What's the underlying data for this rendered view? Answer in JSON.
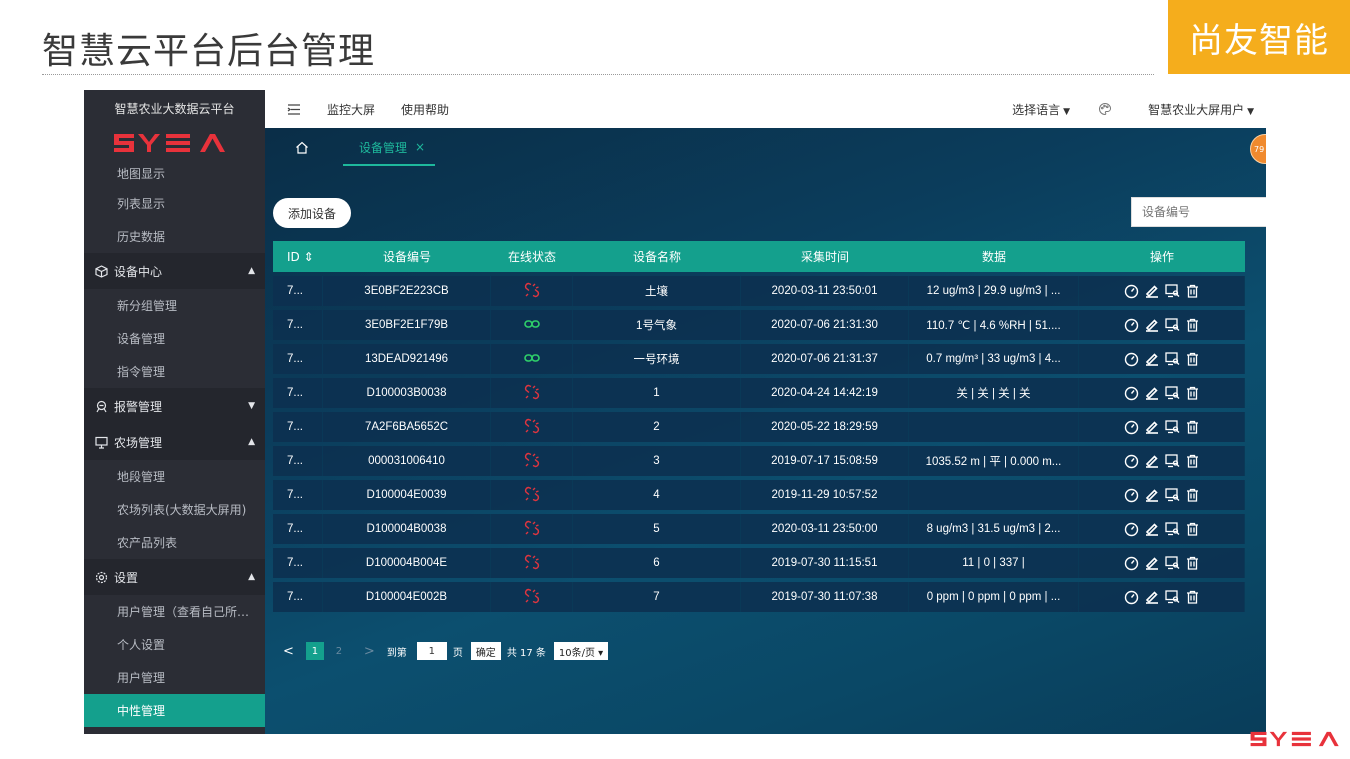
{
  "slide": {
    "title": "智慧云平台后台管理",
    "brand": "尚友智能"
  },
  "sidebar": {
    "title": "智慧农业大数据云平台",
    "items_top": [
      "地图显示",
      "列表显示",
      "历史数据"
    ],
    "group_device": {
      "label": "设备中心",
      "icon": "cube-icon"
    },
    "items_device": [
      "新分组管理",
      "设备管理",
      "指令管理"
    ],
    "group_alarm": {
      "label": "报警管理",
      "icon": "alarm-icon"
    },
    "group_farm": {
      "label": "农场管理",
      "icon": "monitor-icon"
    },
    "items_farm": [
      "地段管理",
      "农场列表(大数据大屏用)",
      "农产品列表"
    ],
    "group_settings": {
      "label": "设置",
      "icon": "gear-icon"
    },
    "items_settings": [
      "用户管理（查看自己所…",
      "个人设置",
      "用户管理",
      "中性管理"
    ]
  },
  "topbar": {
    "nav": [
      "监控大屏",
      "使用帮助"
    ],
    "language": "选择语言",
    "user": "智慧农业大屏用户"
  },
  "tabs": {
    "active": "设备管理",
    "close": "×",
    "badge": "79"
  },
  "toolbar": {
    "add_label": "添加设备",
    "search_placeholder": "设备编号"
  },
  "table": {
    "headers": [
      "ID",
      "设备编号",
      "在线状态",
      "设备名称",
      "采集时间",
      "数据",
      "操作"
    ],
    "sort_icon": "⇕",
    "rows": [
      {
        "id": "7...",
        "code": "3E0BF2E223CB",
        "online": false,
        "name": "土壤",
        "time": "2020-03-11 23:50:01",
        "data": "12 ug/m3 | 29.9 ug/m3 | ..."
      },
      {
        "id": "7...",
        "code": "3E0BF2E1F79B",
        "online": true,
        "name": "1号气象",
        "time": "2020-07-06 21:31:30",
        "data": "110.7 ℃ | 4.6 %RH | 51...."
      },
      {
        "id": "7...",
        "code": "13DEAD921496",
        "online": true,
        "name": "一号环境",
        "time": "2020-07-06 21:31:37",
        "data": "0.7 mg/m³ | 33 ug/m3 | 4..."
      },
      {
        "id": "7...",
        "code": "D100003B0038",
        "online": false,
        "name": "1",
        "time": "2020-04-24 14:42:19",
        "data": "关 | 关 | 关 | 关"
      },
      {
        "id": "7...",
        "code": "7A2F6BA5652C",
        "online": false,
        "name": "2",
        "time": "2020-05-22 18:29:59",
        "data": ""
      },
      {
        "id": "7...",
        "code": "000031006410",
        "online": false,
        "name": "3",
        "time": "2019-07-17 15:08:59",
        "data": "1035.52 m | 平 | 0.000 m..."
      },
      {
        "id": "7...",
        "code": "D100004E0039",
        "online": false,
        "name": "4",
        "time": "2019-11-29 10:57:52",
        "data": ""
      },
      {
        "id": "7...",
        "code": "D100004B0038",
        "online": false,
        "name": "5",
        "time": "2020-03-11 23:50:00",
        "data": "8 ug/m3 | 31.5 ug/m3 | 2..."
      },
      {
        "id": "7...",
        "code": "D100004B004E",
        "online": false,
        "name": "6",
        "time": "2019-07-30 11:15:51",
        "data": "11 | 0 | 337 |"
      },
      {
        "id": "7...",
        "code": "D100004E002B",
        "online": false,
        "name": "7",
        "time": "2019-07-30 11:07:38",
        "data": "0 ppm | 0 ppm | 0 ppm | ..."
      }
    ]
  },
  "pager": {
    "prev": "<",
    "page1": "1",
    "page2": "2",
    "next": ">",
    "goto_label": "到第",
    "goto_value": "1",
    "page_unit": "页",
    "confirm": "确定",
    "total": "共 17 条",
    "page_size": "10条/页 ▾"
  },
  "colors": {
    "accent": "#14a08d",
    "brand_orange": "#f5ad1c",
    "sidebar_bg": "#2b2d35",
    "offline_red": "#e0353f",
    "online_green": "#2fd06a"
  }
}
